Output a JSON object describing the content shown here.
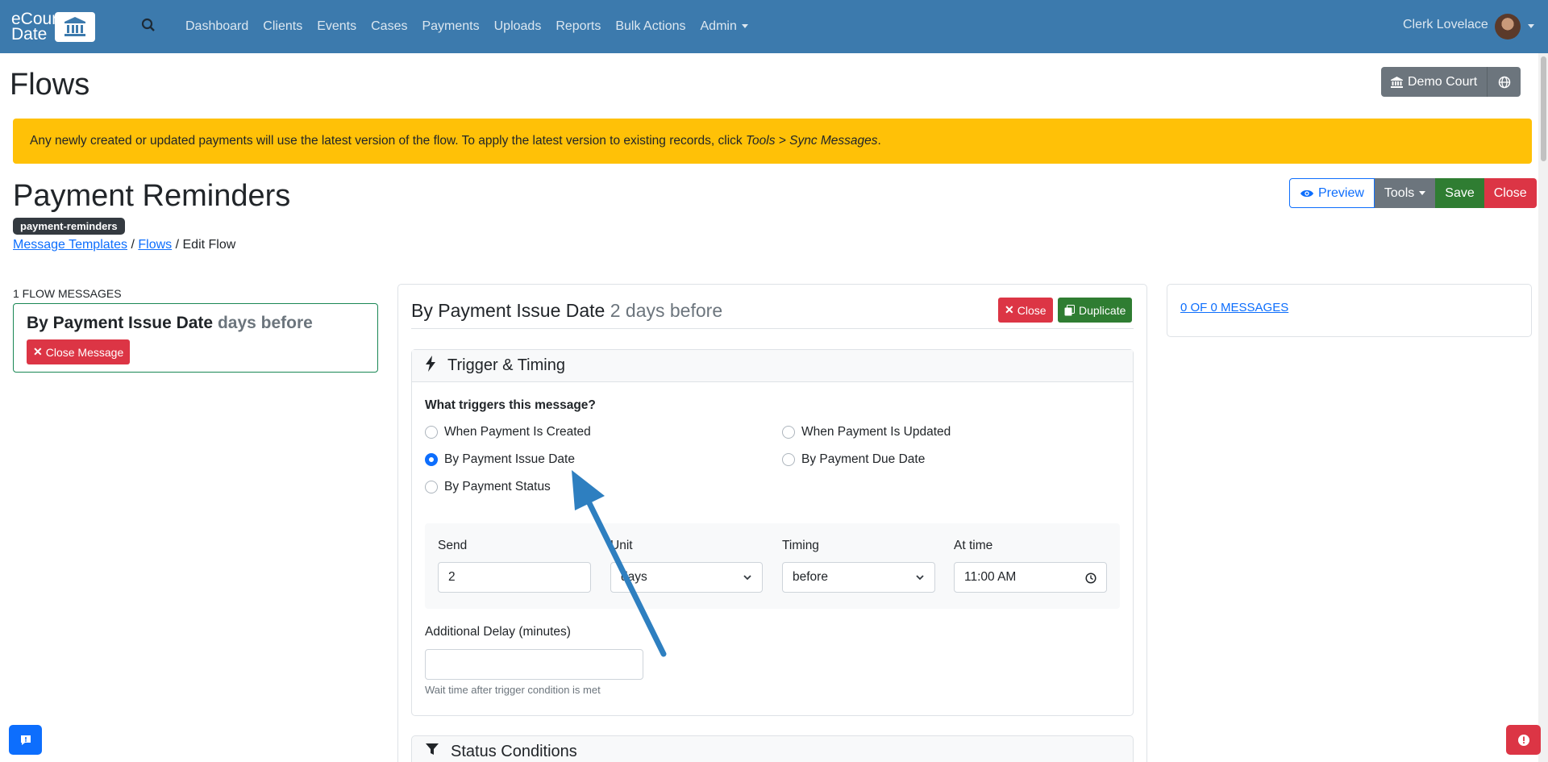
{
  "navbar": {
    "brand_line1": "eCourt",
    "brand_line2": "Date",
    "links": [
      "Dashboard",
      "Clients",
      "Events",
      "Cases",
      "Payments",
      "Uploads",
      "Reports",
      "Bulk Actions",
      "Admin"
    ],
    "user": "Clerk Lovelace"
  },
  "page": {
    "title": "Flows",
    "court_button": "Demo Court"
  },
  "alert": {
    "text": "Any newly created or updated payments will use the latest version of the flow. To apply the latest version to existing records, click ",
    "emphasis": "Tools > Sync Messages",
    "suffix": "."
  },
  "flow": {
    "title": "Payment Reminders",
    "slug": "payment-reminders",
    "breadcrumb": {
      "item1": "Message Templates",
      "sep": "/",
      "item2": "Flows",
      "current": "Edit Flow"
    },
    "actions": {
      "preview": "Preview",
      "tools": "Tools",
      "save": "Save",
      "close": "Close"
    }
  },
  "left": {
    "count_label": "1 Flow Messages",
    "card_title": "By Payment Issue Date",
    "card_suffix": "days before",
    "close_message": "Close Message"
  },
  "editor": {
    "title": "By Payment Issue Date",
    "subtitle": "2 days before",
    "close": "Close",
    "duplicate": "Duplicate",
    "section_trigger": "Trigger & Timing",
    "question": "What triggers this message?",
    "options": {
      "created": "When Payment Is Created",
      "updated": "When Payment Is Updated",
      "issue_date": "By Payment Issue Date",
      "due_date": "By Payment Due Date",
      "status": "By Payment Status"
    },
    "selected": "By Payment Issue Date",
    "send_label": "Send",
    "send_value": "2",
    "unit_label": "Unit",
    "unit_value": "days",
    "timing_label": "Timing",
    "timing_value": "before",
    "attime_label": "At time",
    "attime_value": "11:00 AM",
    "delay_label": "Additional Delay (minutes)",
    "delay_value": "",
    "delay_help": "Wait time after trigger condition is met",
    "section_status": "Status Conditions"
  },
  "side": {
    "messages_link": "0 of 0 Messages"
  },
  "colors": {
    "navbar": "#3c7aad",
    "alert": "#ffc107",
    "primary": "#0d6efd",
    "danger": "#dc3545",
    "success": "#2f7d32",
    "arrow": "#2e7fc0"
  }
}
